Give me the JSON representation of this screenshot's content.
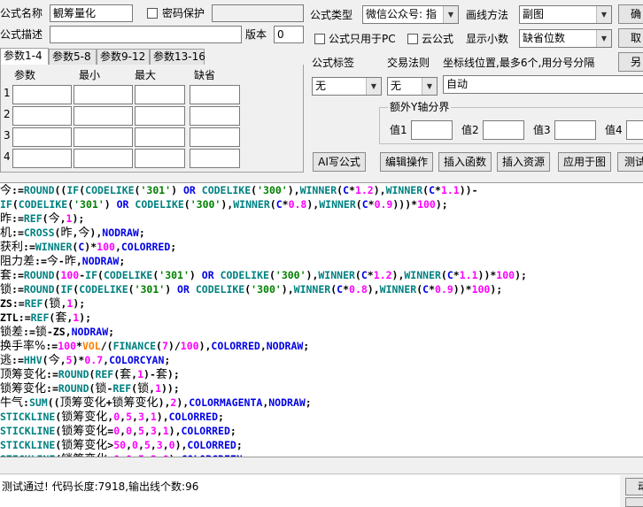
{
  "form": {
    "name_label": "公式名称",
    "name_value": "観筹量化",
    "pwd_label": "密码保护",
    "desc_label": "公式描述",
    "version_label": "版本",
    "version_value": "0",
    "type_label": "公式类型",
    "type_value": "微信公众号: 指",
    "draw_label": "画线方法",
    "draw_value": "副图",
    "pc_only_label": "公式只用于PC",
    "cloud_label": "云公式",
    "decimals_label": "显示小数",
    "decimals_value": "缺省位数",
    "tag_label": "公式标签",
    "tag_value": "无",
    "trade_label": "交易法则",
    "trade_value": "无",
    "coord_label": "坐标线位置,最多6个,用分号分隔",
    "coord_value": "自动",
    "extra_axis_label": "额外Y轴分界",
    "axis_values": [
      "值1",
      "值2",
      "值3",
      "值4"
    ]
  },
  "buttons": {
    "confirm": "确",
    "cancel": "取",
    "save_as": "另",
    "ai": "AI写公式",
    "edit": "编辑操作",
    "insert_func": "插入函数",
    "insert_res": "插入资源",
    "apply": "应用于图",
    "test": "测试"
  },
  "tabs": [
    "参数1-4",
    "参数5-8",
    "参数9-12",
    "参数13-16"
  ],
  "params": {
    "headers": [
      "参数",
      "最小",
      "最大",
      "缺省"
    ],
    "rows": [
      "1",
      "2",
      "3",
      "4"
    ]
  },
  "status": {
    "message": "测试通过! 代码长度:7918,输出线个数:96",
    "side_button": "动"
  }
}
